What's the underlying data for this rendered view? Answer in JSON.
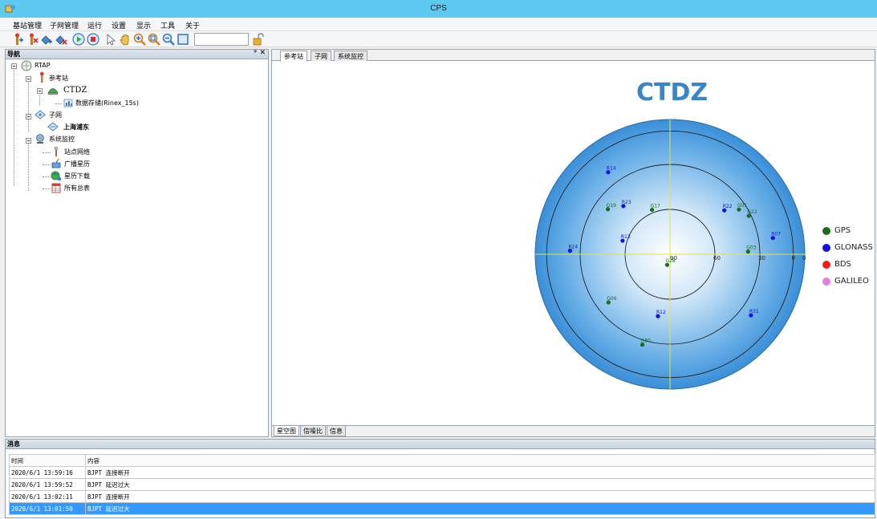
{
  "window": {
    "title": "CPS"
  },
  "menu": [
    "基站管理",
    "子网管理",
    "运行",
    "设置",
    "显示",
    "工具",
    "关于"
  ],
  "toolbar": {
    "input_value": ""
  },
  "nav": {
    "title": "导航",
    "pin": "ᵠ",
    "close": "✕",
    "tree": [
      {
        "label": "RTAP",
        "level": 0
      },
      {
        "label": "参考站",
        "level": 1
      },
      {
        "label": "CTDZ",
        "level": 2
      },
      {
        "label": "数据存储(Rinex_15s)",
        "level": 3
      },
      {
        "label": "子网",
        "level": 1
      },
      {
        "label": "上海浦东",
        "level": 2
      },
      {
        "label": "系统监控",
        "level": 1
      },
      {
        "label": "站点网络",
        "level": 2
      },
      {
        "label": "广播星历",
        "level": 2
      },
      {
        "label": "星历下载",
        "level": 2
      },
      {
        "label": "所有总表",
        "level": 2
      }
    ]
  },
  "doc_tabs": [
    "参考站",
    "子网",
    "系统监控"
  ],
  "bottom_tabs": [
    "星空图",
    "信噪比",
    "信息"
  ],
  "chart_data": {
    "type": "scatter",
    "subtype": "polar-skyplot",
    "title": "CTDZ",
    "elevation_ring_labels": [
      "90",
      "60",
      "30",
      "0"
    ],
    "legend_position": "right",
    "legend": [
      {
        "name": "GPS",
        "color": "#1a6b1a"
      },
      {
        "name": "GLONASS",
        "color": "#1010e0"
      },
      {
        "name": "BDS",
        "color": "#ff1a1a"
      },
      {
        "name": "GALILEO",
        "color": "#e080e0"
      }
    ],
    "satellites": [
      {
        "id": "R14",
        "system": "GLONASS",
        "azimuth": 323,
        "elevation": 15
      },
      {
        "id": "R22",
        "system": "GLONASS",
        "azimuth": 51,
        "elevation": 39
      },
      {
        "id": "G01",
        "system": "GPS",
        "azimuth": 57,
        "elevation": 30
      },
      {
        "id": "G22",
        "system": "GPS",
        "azimuth": 64,
        "elevation": 26
      },
      {
        "id": "G19",
        "system": "GPS",
        "azimuth": 306,
        "elevation": 34
      },
      {
        "id": "R23",
        "system": "GLONASS",
        "azimuth": 316,
        "elevation": 41
      },
      {
        "id": "G17",
        "system": "GPS",
        "azimuth": 338,
        "elevation": 55
      },
      {
        "id": "R07",
        "system": "GLONASS",
        "azimuth": 81,
        "elevation": 14
      },
      {
        "id": "R13",
        "system": "GLONASS",
        "azimuth": 286,
        "elevation": 54
      },
      {
        "id": "G03",
        "system": "GPS",
        "azimuth": 88,
        "elevation": 33
      },
      {
        "id": "R24",
        "system": "GLONASS",
        "azimuth": 272,
        "elevation": 17
      },
      {
        "id": "G28",
        "system": "GPS",
        "azimuth": 195,
        "elevation": 82
      },
      {
        "id": "G06",
        "system": "GPS",
        "azimuth": 232,
        "elevation": 33
      },
      {
        "id": "R12",
        "system": "GLONASS",
        "azimuth": 191,
        "elevation": 44
      },
      {
        "id": "R31",
        "system": "GLONASS",
        "azimuth": 127,
        "elevation": 16
      },
      {
        "id": "G30",
        "system": "GPS",
        "azimuth": 197,
        "elevation": 21
      }
    ]
  },
  "messages": {
    "title": "消息",
    "columns": [
      "时间",
      "内容"
    ],
    "rows": [
      {
        "time": "2020/6/1 13:59:16",
        "content": "BJPT 连接断开"
      },
      {
        "time": "2020/6/1 13:59:52",
        "content": "BJPT 延迟过大"
      },
      {
        "time": "2020/6/1 13:02:11",
        "content": "BJPT 连接断开"
      },
      {
        "time": "2020/6/1 13:01:50",
        "content": "BJPT 延迟过大"
      }
    ]
  }
}
